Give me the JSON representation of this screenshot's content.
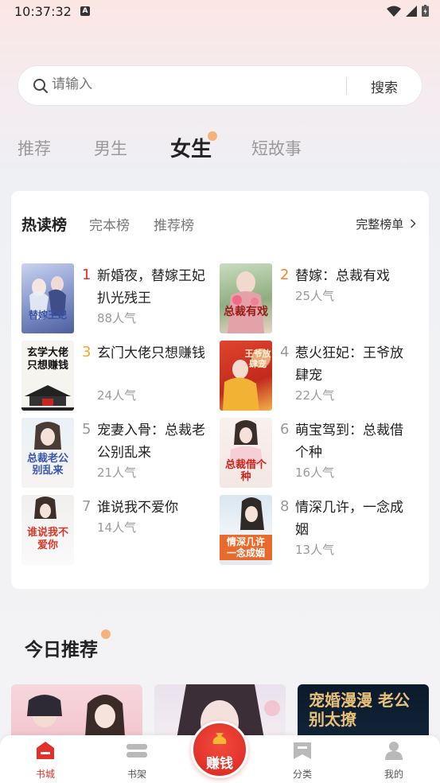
{
  "status": {
    "time": "10:37:32",
    "notif_letter": "A"
  },
  "search": {
    "placeholder": "请输入",
    "button": "搜索"
  },
  "tabs": [
    {
      "label": "推荐"
    },
    {
      "label": "男生"
    },
    {
      "label": "女生",
      "active": true
    },
    {
      "label": "短故事"
    }
  ],
  "ranking": {
    "tabs": [
      {
        "label": "热读榜"
      },
      {
        "label": "完本榜"
      },
      {
        "label": "推荐榜"
      }
    ],
    "full_list": "完整榜单",
    "books": [
      {
        "rank": "1",
        "title": "新婚夜，替嫁王妃扒光残王",
        "popularity": "88人气",
        "cover_text": "替嫁王妃"
      },
      {
        "rank": "2",
        "title": "替嫁：总裁有戏",
        "popularity": "25人气",
        "cover_text": "总裁有戏"
      },
      {
        "rank": "3",
        "title": "玄门大佬只想赚钱",
        "popularity": "24人气",
        "cover_text": "玄学大佬只想赚钱"
      },
      {
        "rank": "4",
        "title": "惹火狂妃：王爷放肆宠",
        "popularity": "22人气",
        "cover_text": "王爷放肆宠"
      },
      {
        "rank": "5",
        "title": "宠妻入骨：总裁老公别乱来",
        "popularity": "21人气",
        "cover_text": "总裁老公别乱来"
      },
      {
        "rank": "6",
        "title": "萌宝驾到：总裁借个种",
        "popularity": "16人气",
        "cover_text": "总裁借个种"
      },
      {
        "rank": "7",
        "title": "谁说我不爱你",
        "popularity": "14人气",
        "cover_text": "谁说我不爱你"
      },
      {
        "rank": "8",
        "title": "情深几许，一念成姻",
        "popularity": "13人气",
        "cover_text": "情深几许一念成姻"
      }
    ]
  },
  "today": {
    "title": "今日推荐",
    "cover3_text": "宠婚漫漫 老公别太撩"
  },
  "colors": {
    "accent": "#e0312a",
    "rank1": "#e0312a",
    "rank2": "#f0832b",
    "rank3": "#f0a82b"
  },
  "nav": {
    "items": [
      {
        "label": "书城",
        "icon": "bookstore-icon",
        "active": true
      },
      {
        "label": "书架",
        "icon": "bookshelf-icon"
      },
      {
        "label": "分类",
        "icon": "category-icon"
      },
      {
        "label": "我的",
        "icon": "profile-icon"
      }
    ],
    "earn": "赚钱"
  }
}
